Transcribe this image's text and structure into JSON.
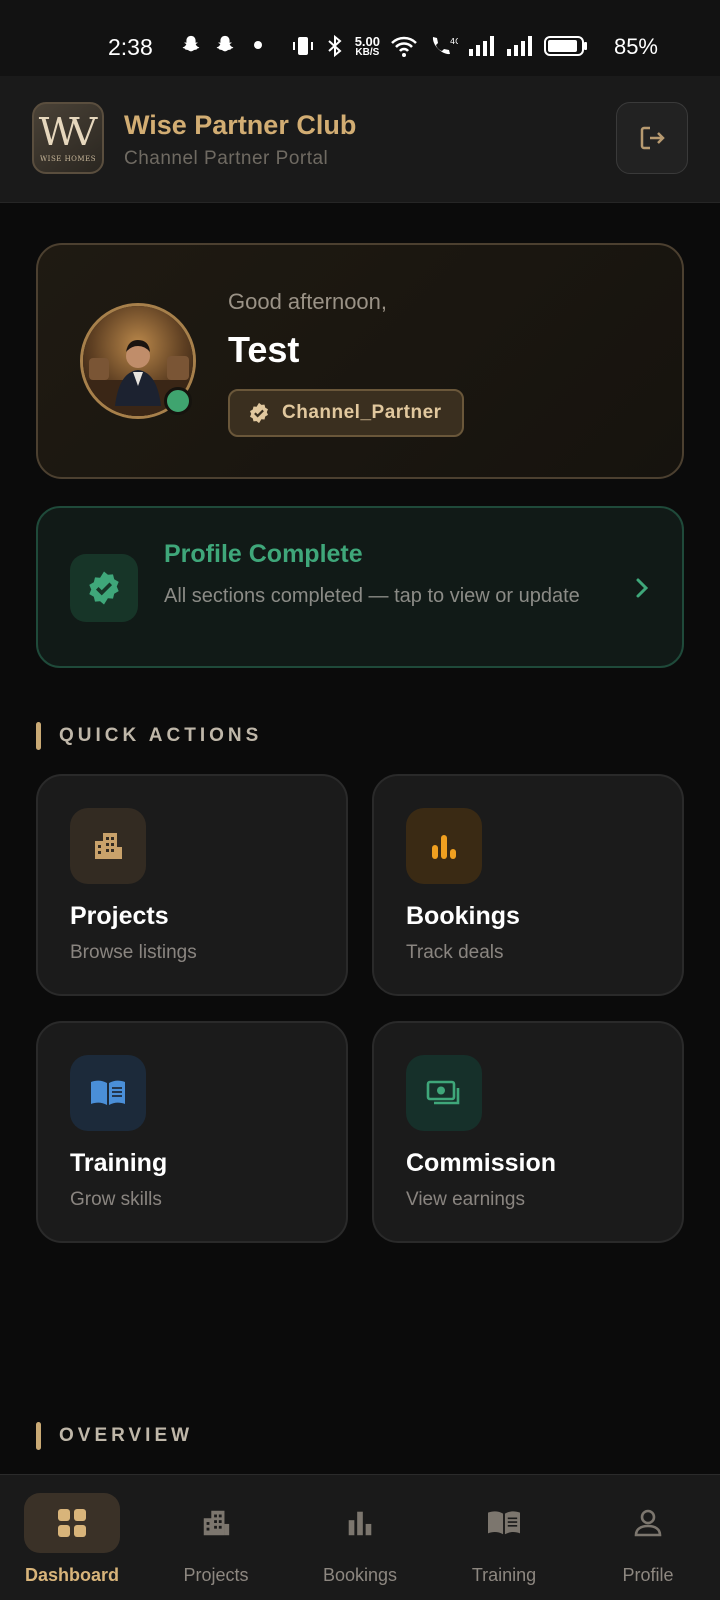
{
  "status_bar": {
    "time": "2:38",
    "network_speed_value": "5.00",
    "network_speed_unit": "KB/S",
    "battery_percent": "85%",
    "icons": [
      "snapchat-icon",
      "snapchat-icon",
      "dot-icon",
      "vibrate-icon",
      "bluetooth-icon",
      "wifi-icon",
      "volte-call-icon",
      "signal-icon",
      "signal-icon",
      "battery-icon"
    ]
  },
  "header": {
    "app_title": "Wise Partner Club",
    "app_subtitle": "Channel Partner Portal",
    "logo_text": "WISE HOMES",
    "logout_icon": "logout-icon"
  },
  "greeting": {
    "salutation": "Good afternoon,",
    "name": "Test",
    "role": "Channel_Partner",
    "online": true
  },
  "profile_status": {
    "title": "Profile Complete",
    "description": "All sections completed — tap to view or update"
  },
  "quick_actions": {
    "section_title": "QUICK ACTIONS",
    "items": [
      {
        "title": "Projects",
        "subtitle": "Browse listings",
        "icon": "building-icon",
        "color": "#c9a26b"
      },
      {
        "title": "Bookings",
        "subtitle": "Track deals",
        "icon": "bar-chart-icon",
        "color": "#f0a020"
      },
      {
        "title": "Training",
        "subtitle": "Grow skills",
        "icon": "book-icon",
        "color": "#4a8fd8"
      },
      {
        "title": "Commission",
        "subtitle": "View earnings",
        "icon": "money-icon",
        "color": "#3fa77a"
      }
    ]
  },
  "overview": {
    "section_title": "OVERVIEW"
  },
  "bottom_nav": {
    "active": "Dashboard",
    "items": [
      {
        "label": "Dashboard",
        "icon": "grid-icon"
      },
      {
        "label": "Projects",
        "icon": "building-icon"
      },
      {
        "label": "Bookings",
        "icon": "bar-chart-icon"
      },
      {
        "label": "Training",
        "icon": "book-icon"
      },
      {
        "label": "Profile",
        "icon": "person-icon"
      }
    ]
  },
  "colors": {
    "gold_accent": "#d2ad73",
    "success_green": "#3fa77a",
    "background": "#0b0b0b",
    "card": "#1b1b1b"
  }
}
